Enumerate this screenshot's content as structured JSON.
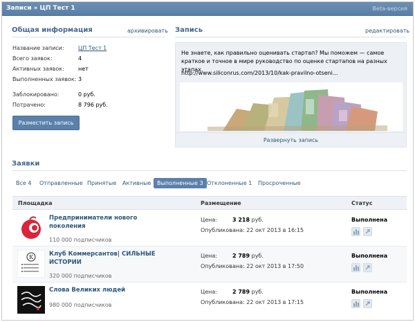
{
  "header": {
    "breadcrumb_root": "Записи",
    "breadcrumb_sep": "»",
    "breadcrumb_current": "ЦП Тест 1",
    "beta_label": "Beta-версия"
  },
  "general": {
    "title": "Общая информация",
    "archive_link": "архивировать",
    "rows": [
      {
        "label": "Название записи:",
        "value": "ЦП Тест 1"
      },
      {
        "label": "Всего заявок:",
        "value": "4"
      },
      {
        "label": "Активных заявок:",
        "value": "нет"
      },
      {
        "label": "Выполненных заявок:",
        "value": "3"
      },
      {
        "label": "Заблокировано:",
        "value": "0 руб."
      },
      {
        "label": "Потрачено:",
        "value": "8 796 руб."
      }
    ],
    "place_button": "Разместить запись"
  },
  "post": {
    "title": "Запись",
    "edit_link": "редактировать",
    "text": "Не знаете, как правильно оценивать стартап? Мы поможем — самое краткое и точное в мире руководство по оценке стартапов на разных этапах.",
    "url": "http://www.siliconrus.com/2013/10/kak-pravilno-otseni...",
    "expand": "Развернуть запись"
  },
  "requests": {
    "title": "Заявки",
    "tabs": [
      {
        "label": "Все",
        "count": "4"
      },
      {
        "label": "Отправленные",
        "count": ""
      },
      {
        "label": "Принятые",
        "count": ""
      },
      {
        "label": "Активные",
        "count": ""
      },
      {
        "label": "Выполненные",
        "count": "3"
      },
      {
        "label": "Отклоненные",
        "count": "1"
      },
      {
        "label": "Просроченные",
        "count": ""
      }
    ],
    "columns": {
      "platform": "Площадка",
      "placement": "Размещение",
      "status": "Статус"
    },
    "rows": [
      {
        "name": "Предприниматели нового поколения",
        "subscribers": "110 000 подписчиков",
        "price_label": "Цена:",
        "price": "3 218",
        "price_unit": "руб.",
        "published_label": "Опубликована:",
        "published": "22 окт 2013 в 16:15",
        "status": "Выполнена"
      },
      {
        "name": "Клуб Коммерсантов| СИЛЬНЫЕ ИСТОРИИ",
        "subscribers": "320 000 подписчиков",
        "price_label": "Цена:",
        "price": "2 789",
        "price_unit": "руб.",
        "published_label": "Опубликована:",
        "published": "22 окт 2013 в 17:50",
        "status": "Выполнена"
      },
      {
        "name": "Слова Великих людей",
        "subscribers": "980 000 подписчиков",
        "price_label": "Цена:",
        "price": "2 789",
        "price_unit": "руб.",
        "published_label": "Опубликована:",
        "published": "22 окт 2013 в 17:15",
        "status": "Выполнена"
      }
    ]
  },
  "colors": {
    "header_bg": "#5b80aa",
    "link": "#2b587a",
    "section_title": "#45688e",
    "button": "#5b80aa"
  }
}
